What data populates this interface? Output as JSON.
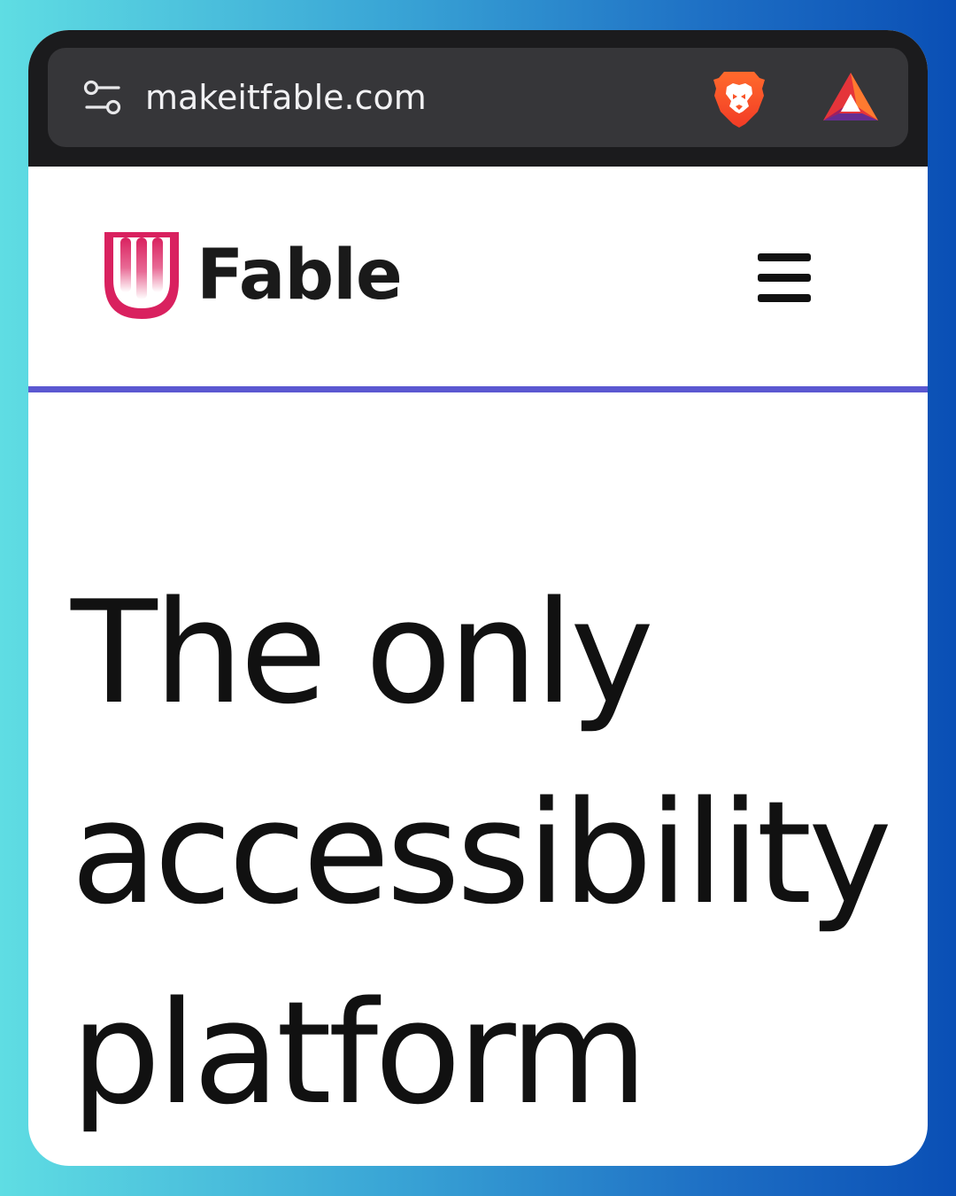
{
  "browser": {
    "url": "makeitfable.com",
    "icons": {
      "site_settings": "tune-icon",
      "shield": "brave-lion-icon",
      "rewards": "bat-triangle-icon"
    }
  },
  "header": {
    "logo_text": "Fable",
    "menu_icon": "hamburger-menu-icon"
  },
  "hero": {
    "title_lines": [
      "The only",
      "accessibility",
      "platform"
    ]
  },
  "colors": {
    "brand_pink": "#d9215f",
    "divider_purple": "#5b58d1",
    "browser_bg": "#1b1b1d",
    "url_pill_bg": "#363639",
    "brave_orange": "#fb542b"
  }
}
